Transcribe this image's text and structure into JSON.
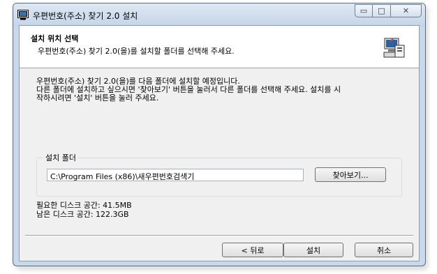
{
  "window": {
    "title": "우편번호(주소) 찾기 2.0 설치",
    "buttons": {
      "minimize": "▭",
      "maximize": "□",
      "close": "✕"
    }
  },
  "header": {
    "title": "설치 위치 선택",
    "subtitle": "우편번호(주소) 찾기 2.0(을)를 설치할 폴더를 선택해 주세요."
  },
  "intro": {
    "line1": "우편번호(주소) 찾기 2.0(을)를 다음 폴더에 설치할 예정입니다.",
    "line2": "다른 폴더에 설치하고 싶으시면 '찾아보기' 버튼을 눌러서 다른 폴더를 선택해 주세요. 설치를 시",
    "line3": "작하시려면 '설치' 버튼을 눌러 주세요."
  },
  "install_folder": {
    "label": "설치 폴더",
    "path": "C:\\Program Files (x86)\\새우편번호검색기",
    "browse_label": "찾아보기..."
  },
  "disk": {
    "required": "필요한 디스크 공간: 41.5MB",
    "available": "남은 디스크 공간: 122.3GB"
  },
  "footer": {
    "back_label": "< 뒤로",
    "install_label": "설치",
    "cancel_label": "취소"
  },
  "icons": {
    "app": "installer-app-icon",
    "header": "installer-computer-icon"
  }
}
